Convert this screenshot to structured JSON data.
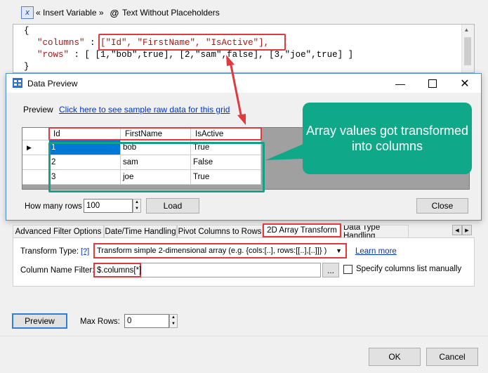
{
  "toolbar": {
    "insert_variable": "« Insert Variable »",
    "text_without_placeholders": "Text Without Placeholders"
  },
  "editor": {
    "line1": "{",
    "line2_key": "\"columns\"",
    "line2_sep": " : ",
    "line2_val": "[\"Id\", \"FirstName\", \"IsActive\"],",
    "line3_key": "\"rows\"",
    "line3_sep": " : ",
    "line3_val": "[ [1,\"bob\",true], [2,\"sam\",false], [3,\"joe\",true] ]",
    "line4": "}"
  },
  "dialog": {
    "title": "Data Preview",
    "preview_label": "Preview",
    "sample_link": "Click here to see sample raw data for this grid",
    "grid": {
      "columns": [
        "Id",
        "FirstName",
        "IsActive"
      ],
      "rows": [
        [
          "1",
          "bob",
          "True"
        ],
        [
          "2",
          "sam",
          "False"
        ],
        [
          "3",
          "joe",
          "True"
        ]
      ]
    },
    "how_many_rows_label": "How many rows",
    "how_many_rows_value": "100",
    "load_button": "Load",
    "close_button": "Close"
  },
  "callout": "Array values got transformed into columns",
  "tabs": [
    "Advanced Filter Options",
    "Date/Time Handling",
    "Pivot Columns to Rows",
    "2D Array Transform",
    "Data Type Handling"
  ],
  "transform": {
    "type_label": "Transform Type:",
    "help": "[?]",
    "type_value": "Transform simple 2-dimensional array (e.g. {cols:[..], rows:[[..],[..]]} )",
    "learn_more": "Learn more",
    "column_filter_label": "Column Name Filter:",
    "column_filter_value": "$.columns[*]",
    "browse": "...",
    "specify_manually": "Specify columns list manually"
  },
  "bottom": {
    "preview_button": "Preview",
    "max_rows_label": "Max Rows:",
    "max_rows_value": "0",
    "ok_button": "OK",
    "cancel_button": "Cancel"
  },
  "colors": {
    "highlight_red": "#e0393e",
    "callout_green": "#0fa98a",
    "teal_outline": "#16a085",
    "selection_blue": "#0078d7"
  }
}
